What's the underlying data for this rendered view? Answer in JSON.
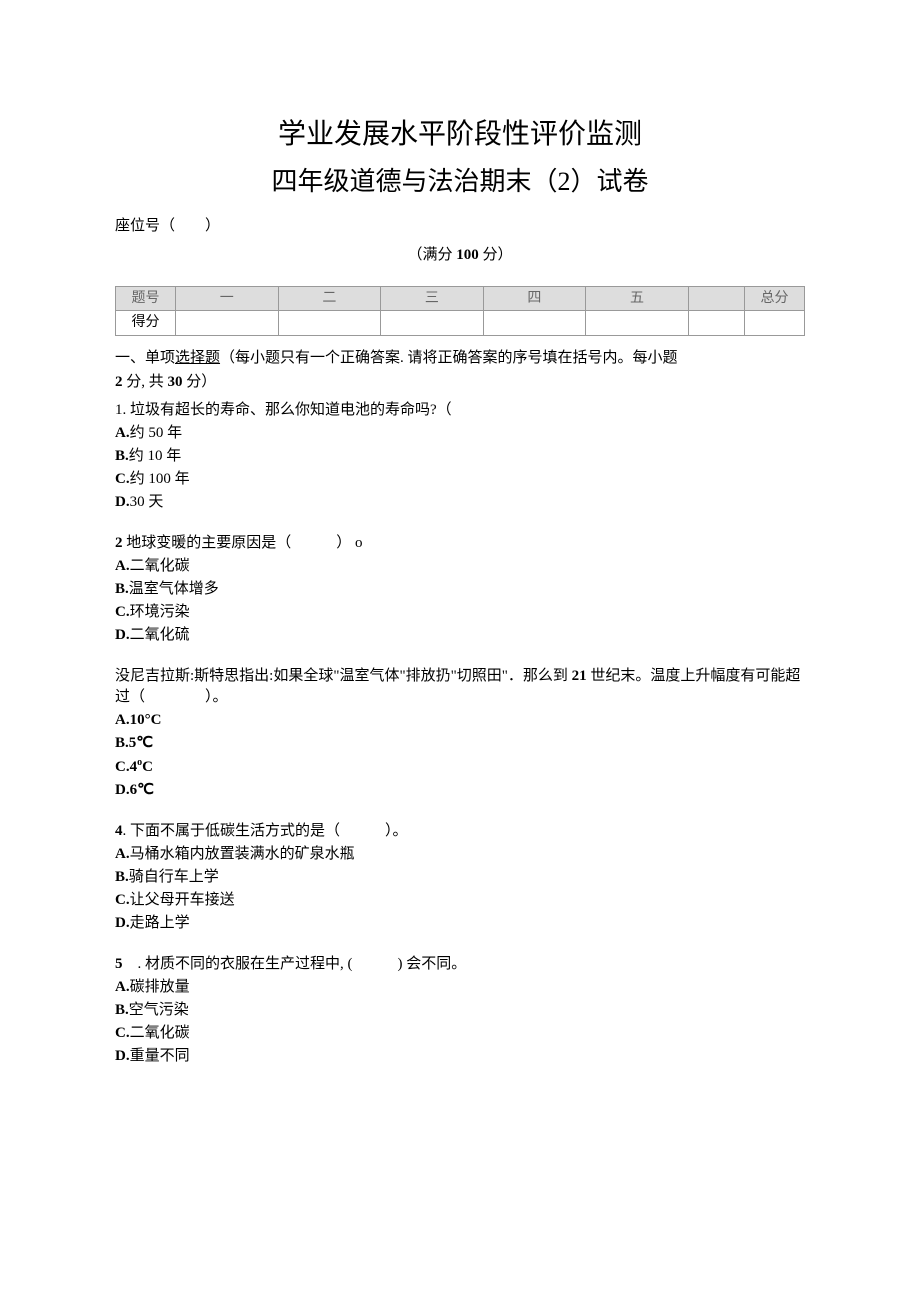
{
  "title_line1": "学业发展水平阶段性评价监测",
  "title_line2": "四年级道德与法治期末（2）试卷",
  "seat_label": "座位号（　　）",
  "fullmark": "（满分 100 分）",
  "table": {
    "r1": [
      "题号",
      "一",
      "二",
      "三",
      "四",
      "五",
      "",
      "总分"
    ],
    "r2": [
      "得分",
      "",
      "",
      "",
      "",
      "",
      "",
      ""
    ]
  },
  "section1_intro_a": "一、单项",
  "section1_intro_b": "选择题",
  "section1_intro_c": "（每小题只有一个正确答案. 请将正确答案的序号填在括号内。每小题",
  "section1_intro_d": "2 分, 共 30 分）",
  "q1": {
    "stem": "1. 垃圾有超长的寿命、那么你知道电池的寿命吗?（",
    "a_label": "A.",
    "a": "约 50 年",
    "b_label": "B.",
    "b": "约 10 年",
    "c_label": "C.",
    "c": "约 100 年",
    "d_label": "D.",
    "d": "30 天"
  },
  "q2": {
    "stem_a": "2",
    "stem_b": " 地球变暖的主要原因是（　　　） o",
    "a_label": "A.",
    "a": "二氧化碳",
    "b_label": "B.",
    "b": "温室气体增多",
    "c_label": "C.",
    "c": "环境污染",
    "d_label": "D.",
    "d": "二氧化硫"
  },
  "q3": {
    "stem_a": "没尼吉拉斯:斯特思指出:如果全球\"温室气体\"排放扔\"切照田\"．那么到 ",
    "stem_b": "21",
    "stem_c": " 世纪末。温度上升幅度有可能超过（　　　　）。",
    "a": "A.10°C",
    "b": "B.5℃",
    "c_label": "C.4",
    "c_sup": "o",
    "c_unit": "C",
    "d": "D.6℃"
  },
  "q4": {
    "stem_a": "4",
    "stem_b": ". 下面不属于低碳生活方式的是（　　　）。",
    "a_label": "A.",
    "a": "马桶水箱内放置装满水的矿泉水瓶",
    "b_label": "B.",
    "b": "骑自行车上学",
    "c_label": "C.",
    "c": "让父母开车接送",
    "d_label": "D.",
    "d": "走路上学"
  },
  "q5": {
    "stem_a": "5",
    "stem_b": "　. 材质不同的衣服在生产过程中, (　　　) 会不同。",
    "a_label": "A.",
    "a": "碳排放量",
    "b_label": "B.",
    "b": "空气污染",
    "c_label": "C.",
    "c": "二氧化碳",
    "d_label": "D.",
    "d": "重量不同"
  }
}
